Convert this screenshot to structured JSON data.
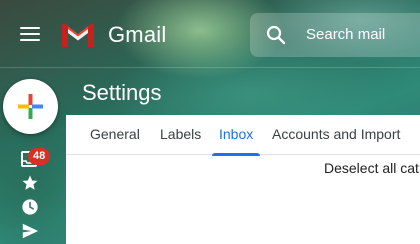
{
  "header": {
    "app_name": "Gmail",
    "menu_icon": "hamburger-menu-icon",
    "logo_icon": "gmail-m-logo",
    "search": {
      "placeholder": "Search mail",
      "icon": "search-icon"
    }
  },
  "sidebar": {
    "compose_icon": "plus-icon",
    "items": [
      {
        "icon": "inbox-icon",
        "badge": "48"
      },
      {
        "icon": "star-icon"
      },
      {
        "icon": "clock-icon"
      },
      {
        "icon": "send-icon"
      }
    ]
  },
  "page": {
    "title": "Settings"
  },
  "tabs": [
    {
      "label": "General",
      "active": false
    },
    {
      "label": "Labels",
      "active": false
    },
    {
      "label": "Inbox",
      "active": true
    },
    {
      "label": "Accounts and Import",
      "active": false
    }
  ],
  "content": {
    "deselect_text": "Deselect all cat"
  },
  "colors": {
    "accent": "#1a73e8",
    "badge": "#d93025"
  }
}
